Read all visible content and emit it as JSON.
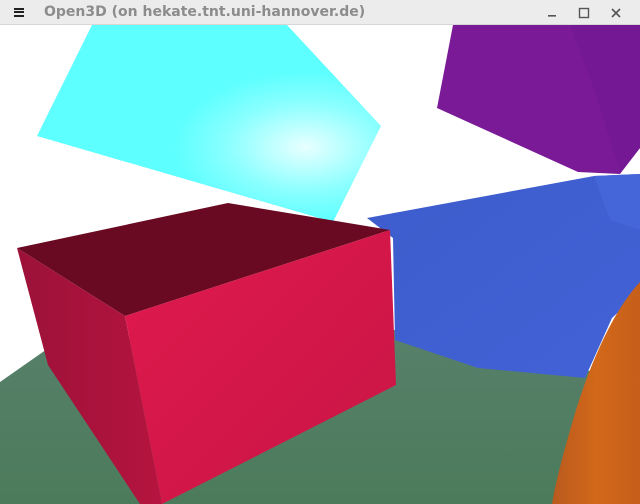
{
  "window": {
    "title": "Open3D (on hekate.tnt.uni-hannover.de)",
    "controls": [
      "minimize",
      "maximize",
      "close"
    ]
  },
  "icons": {
    "menu": "hamburger-menu-icon",
    "minimize": "minimize-icon",
    "maximize": "maximize-icon",
    "close": "close-icon"
  },
  "scene": {
    "background": "#ffffff",
    "colors": {
      "ground": "#4f7c5d",
      "cyan_box": "#5effff",
      "purple_box": "#7a1a96",
      "blue_box": "#3f5fd0",
      "red_box_front": "#d4194a",
      "red_box_side": "#a5133a",
      "red_box_top": "#6a0a22",
      "orange_object": "#c8611c"
    }
  }
}
